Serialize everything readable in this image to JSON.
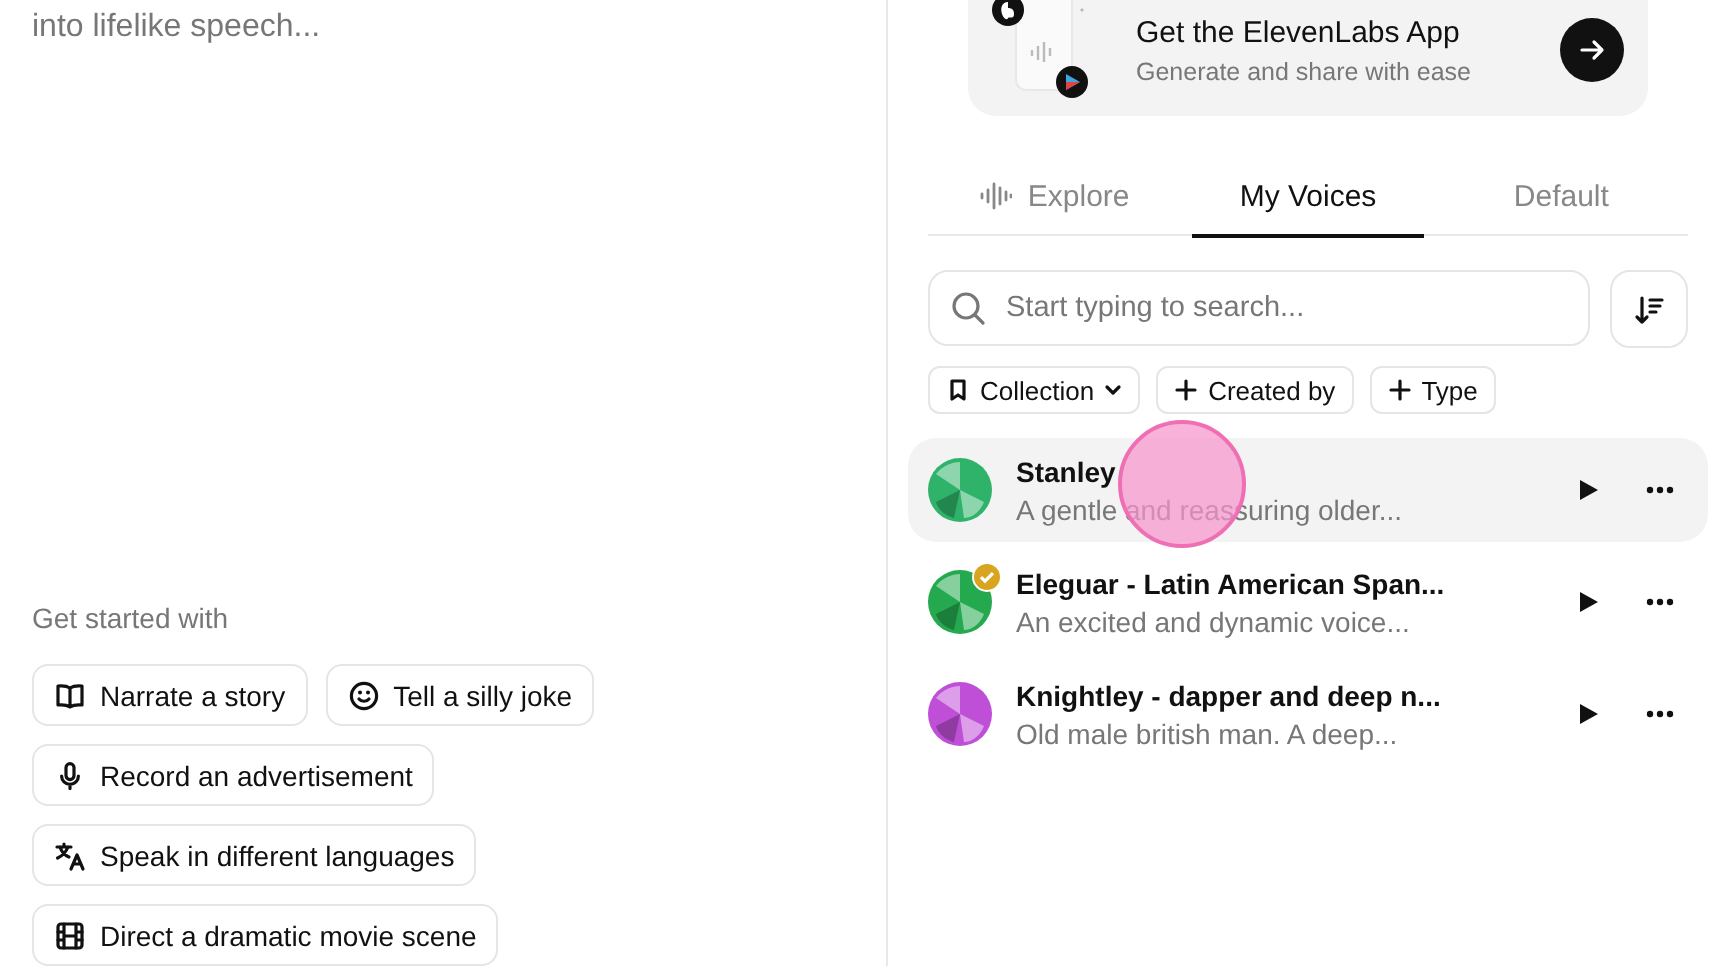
{
  "editor": {
    "placeholder": "into lifelike speech..."
  },
  "get_started": {
    "heading": "Get started with",
    "suggestions": [
      {
        "label": "Narrate a story",
        "kind": "book"
      },
      {
        "label": "Tell a silly joke",
        "kind": "smiley"
      },
      {
        "label": "Record an advertisement",
        "kind": "mic"
      },
      {
        "label": "Speak in different languages",
        "kind": "translate"
      },
      {
        "label": "Direct a dramatic movie scene",
        "kind": "film"
      }
    ]
  },
  "app_banner": {
    "title": "Get the ElevenLabs App",
    "subtitle": "Generate and share with ease"
  },
  "tabs": [
    {
      "label": "Explore",
      "kind": "waveform",
      "selected": false
    },
    {
      "label": "My Voices",
      "kind": "plain",
      "selected": true
    },
    {
      "label": "Default",
      "kind": "plain",
      "selected": false
    }
  ],
  "search": {
    "placeholder": "Start typing to search..."
  },
  "filters": [
    {
      "label": "Collection",
      "kind": "dropdown"
    },
    {
      "label": "Created by",
      "kind": "add"
    },
    {
      "label": "Type",
      "kind": "add"
    }
  ],
  "voices": [
    {
      "name": "Stanley",
      "description": "A gentle and reassuring older...",
      "color": "#2fb36a",
      "verified": false,
      "highlighted": true
    },
    {
      "name": "Eleguar - Latin American Span...",
      "description": "An excited and dynamic voice...",
      "color": "#24a94e",
      "verified": true,
      "highlighted": false
    },
    {
      "name": "Knightley - dapper and deep n...",
      "description": "Old male british man. A deep...",
      "color": "#c04fd8",
      "verified": false,
      "highlighted": false
    }
  ],
  "touch_indicator": {
    "visible": true
  }
}
